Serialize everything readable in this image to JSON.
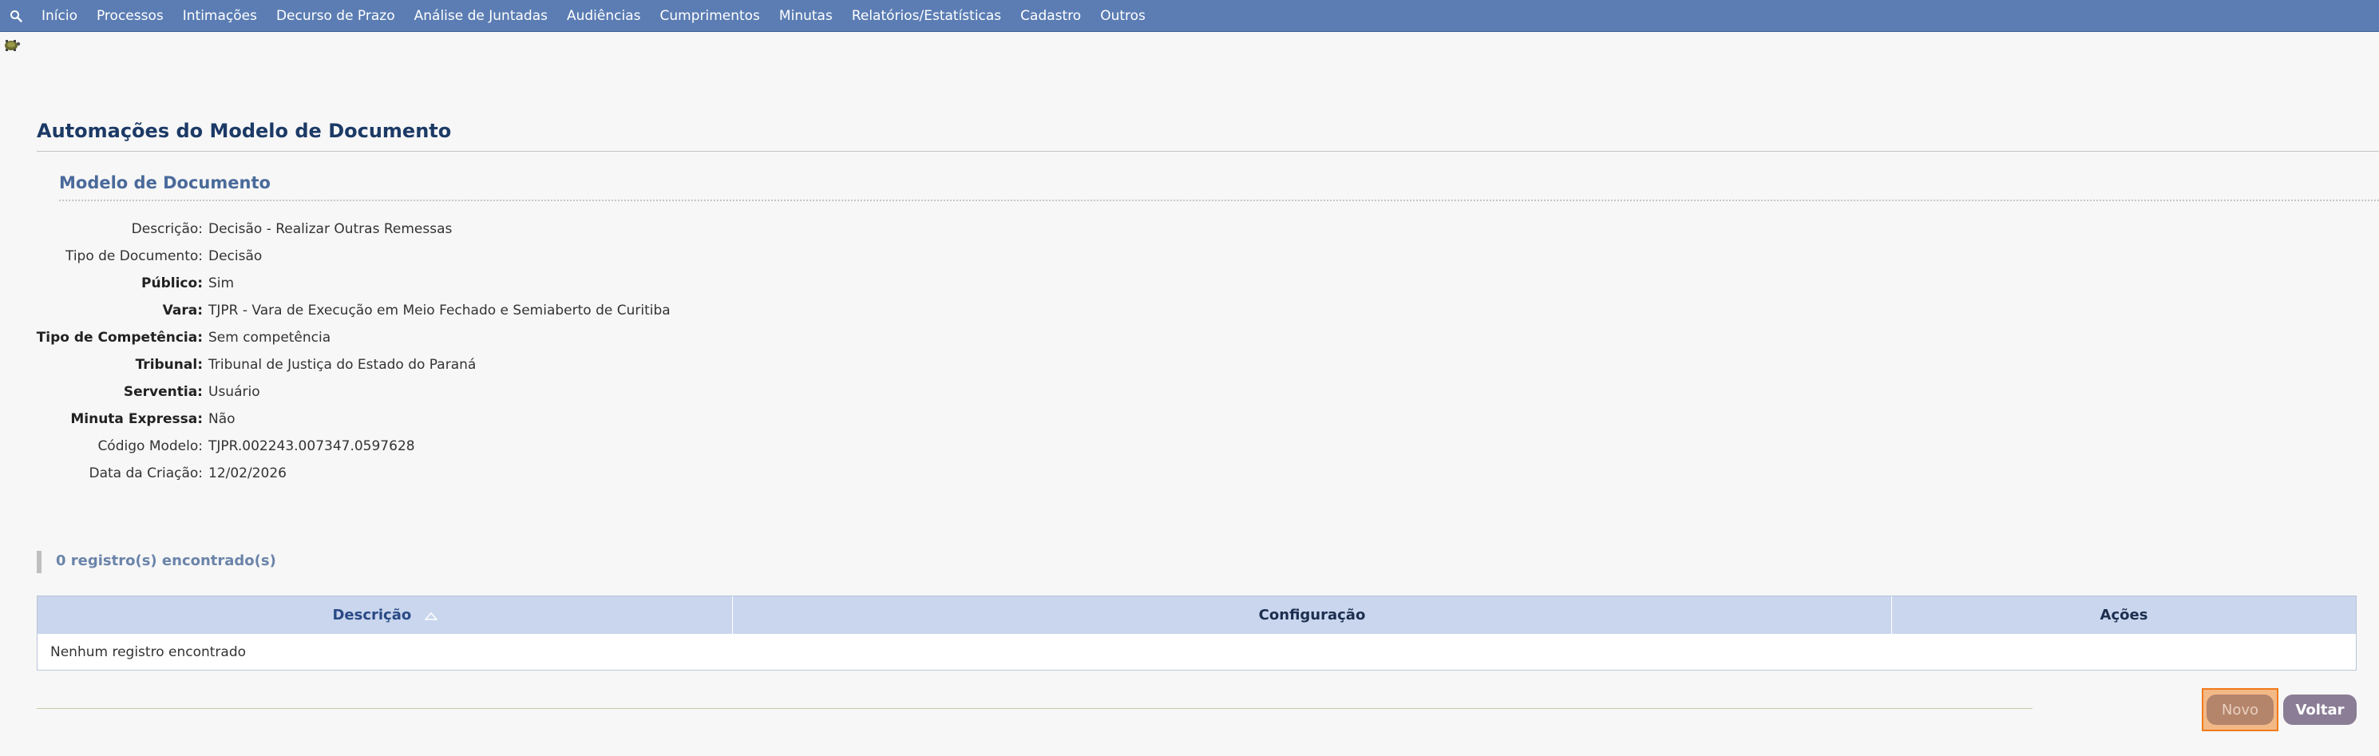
{
  "nav": {
    "items": [
      {
        "label": "Início"
      },
      {
        "label": "Processos"
      },
      {
        "label": "Intimações"
      },
      {
        "label": "Decurso de Prazo"
      },
      {
        "label": "Análise de Juntadas"
      },
      {
        "label": "Audiências"
      },
      {
        "label": "Cumprimentos"
      },
      {
        "label": "Minutas"
      },
      {
        "label": "Relatórios/Estatísticas"
      },
      {
        "label": "Cadastro"
      },
      {
        "label": "Outros"
      }
    ],
    "search_icon": "search-icon",
    "color": "#5b7db3"
  },
  "page": {
    "title": "Automações do Modelo de Documento",
    "section_title": "Modelo de Documento"
  },
  "fields": [
    {
      "label": "Descrição:",
      "value": "Decisão - Realizar Outras Remessas"
    },
    {
      "label": "Tipo de Documento:",
      "value": "Decisão"
    },
    {
      "label": "Público:",
      "value": "Sim"
    },
    {
      "label": "Vara:",
      "value": "TJPR - Vara de Execução em Meio Fechado e Semiaberto de Curitiba"
    },
    {
      "label": "Tipo de Competência:",
      "value": "Sem competência"
    },
    {
      "label": "Tribunal:",
      "value": "Tribunal de Justiça do Estado do Paraná"
    },
    {
      "label": "Serventia:",
      "value": "Usuário"
    },
    {
      "label": "Minuta Expressa:",
      "value": "Não"
    },
    {
      "label": "Código Modelo:",
      "value": "TJPR.002243.007347.0597628"
    },
    {
      "label": "Data da Criação:",
      "value": "12/02/2026"
    }
  ],
  "records": {
    "count_text": "0 registro(s) encontrado(s)"
  },
  "table": {
    "columns": [
      "Descrição",
      "Configuração",
      "Ações"
    ],
    "empty_text": "Nenhum registro encontrado"
  },
  "buttons": {
    "novo": "Novo",
    "voltar": "Voltar"
  }
}
